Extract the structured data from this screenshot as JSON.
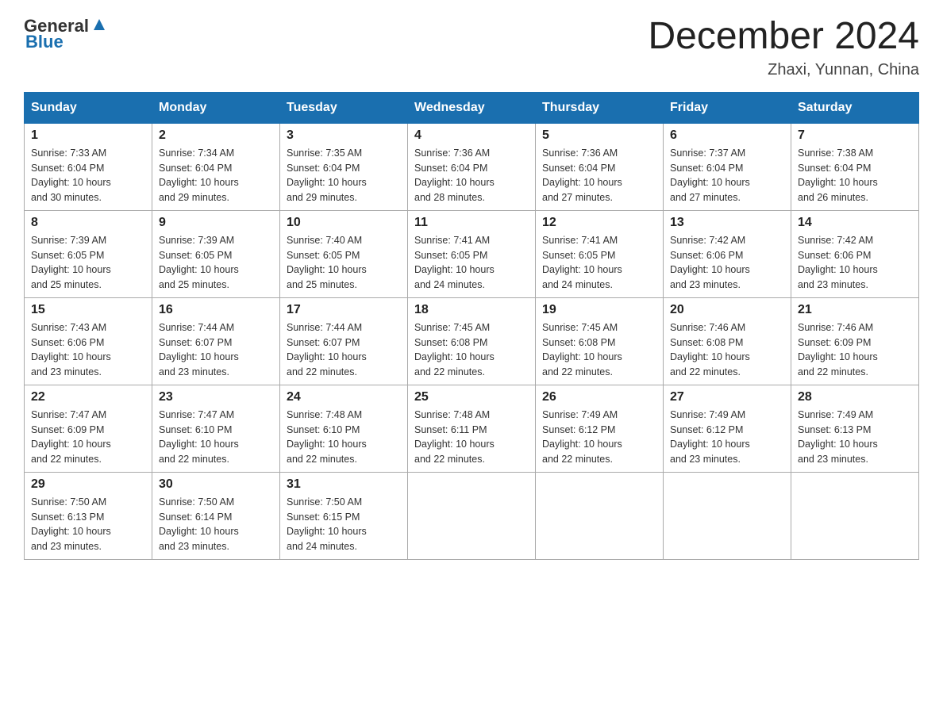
{
  "header": {
    "logo_general": "General",
    "logo_blue": "Blue",
    "month_title": "December 2024",
    "location": "Zhaxi, Yunnan, China"
  },
  "weekdays": [
    "Sunday",
    "Monday",
    "Tuesday",
    "Wednesday",
    "Thursday",
    "Friday",
    "Saturday"
  ],
  "weeks": [
    [
      {
        "day": "1",
        "sunrise": "7:33 AM",
        "sunset": "6:04 PM",
        "daylight": "10 hours and 30 minutes."
      },
      {
        "day": "2",
        "sunrise": "7:34 AM",
        "sunset": "6:04 PM",
        "daylight": "10 hours and 29 minutes."
      },
      {
        "day": "3",
        "sunrise": "7:35 AM",
        "sunset": "6:04 PM",
        "daylight": "10 hours and 29 minutes."
      },
      {
        "day": "4",
        "sunrise": "7:36 AM",
        "sunset": "6:04 PM",
        "daylight": "10 hours and 28 minutes."
      },
      {
        "day": "5",
        "sunrise": "7:36 AM",
        "sunset": "6:04 PM",
        "daylight": "10 hours and 27 minutes."
      },
      {
        "day": "6",
        "sunrise": "7:37 AM",
        "sunset": "6:04 PM",
        "daylight": "10 hours and 27 minutes."
      },
      {
        "day": "7",
        "sunrise": "7:38 AM",
        "sunset": "6:04 PM",
        "daylight": "10 hours and 26 minutes."
      }
    ],
    [
      {
        "day": "8",
        "sunrise": "7:39 AM",
        "sunset": "6:05 PM",
        "daylight": "10 hours and 25 minutes."
      },
      {
        "day": "9",
        "sunrise": "7:39 AM",
        "sunset": "6:05 PM",
        "daylight": "10 hours and 25 minutes."
      },
      {
        "day": "10",
        "sunrise": "7:40 AM",
        "sunset": "6:05 PM",
        "daylight": "10 hours and 25 minutes."
      },
      {
        "day": "11",
        "sunrise": "7:41 AM",
        "sunset": "6:05 PM",
        "daylight": "10 hours and 24 minutes."
      },
      {
        "day": "12",
        "sunrise": "7:41 AM",
        "sunset": "6:05 PM",
        "daylight": "10 hours and 24 minutes."
      },
      {
        "day": "13",
        "sunrise": "7:42 AM",
        "sunset": "6:06 PM",
        "daylight": "10 hours and 23 minutes."
      },
      {
        "day": "14",
        "sunrise": "7:42 AM",
        "sunset": "6:06 PM",
        "daylight": "10 hours and 23 minutes."
      }
    ],
    [
      {
        "day": "15",
        "sunrise": "7:43 AM",
        "sunset": "6:06 PM",
        "daylight": "10 hours and 23 minutes."
      },
      {
        "day": "16",
        "sunrise": "7:44 AM",
        "sunset": "6:07 PM",
        "daylight": "10 hours and 23 minutes."
      },
      {
        "day": "17",
        "sunrise": "7:44 AM",
        "sunset": "6:07 PM",
        "daylight": "10 hours and 22 minutes."
      },
      {
        "day": "18",
        "sunrise": "7:45 AM",
        "sunset": "6:08 PM",
        "daylight": "10 hours and 22 minutes."
      },
      {
        "day": "19",
        "sunrise": "7:45 AM",
        "sunset": "6:08 PM",
        "daylight": "10 hours and 22 minutes."
      },
      {
        "day": "20",
        "sunrise": "7:46 AM",
        "sunset": "6:08 PM",
        "daylight": "10 hours and 22 minutes."
      },
      {
        "day": "21",
        "sunrise": "7:46 AM",
        "sunset": "6:09 PM",
        "daylight": "10 hours and 22 minutes."
      }
    ],
    [
      {
        "day": "22",
        "sunrise": "7:47 AM",
        "sunset": "6:09 PM",
        "daylight": "10 hours and 22 minutes."
      },
      {
        "day": "23",
        "sunrise": "7:47 AM",
        "sunset": "6:10 PM",
        "daylight": "10 hours and 22 minutes."
      },
      {
        "day": "24",
        "sunrise": "7:48 AM",
        "sunset": "6:10 PM",
        "daylight": "10 hours and 22 minutes."
      },
      {
        "day": "25",
        "sunrise": "7:48 AM",
        "sunset": "6:11 PM",
        "daylight": "10 hours and 22 minutes."
      },
      {
        "day": "26",
        "sunrise": "7:49 AM",
        "sunset": "6:12 PM",
        "daylight": "10 hours and 22 minutes."
      },
      {
        "day": "27",
        "sunrise": "7:49 AM",
        "sunset": "6:12 PM",
        "daylight": "10 hours and 23 minutes."
      },
      {
        "day": "28",
        "sunrise": "7:49 AM",
        "sunset": "6:13 PM",
        "daylight": "10 hours and 23 minutes."
      }
    ],
    [
      {
        "day": "29",
        "sunrise": "7:50 AM",
        "sunset": "6:13 PM",
        "daylight": "10 hours and 23 minutes."
      },
      {
        "day": "30",
        "sunrise": "7:50 AM",
        "sunset": "6:14 PM",
        "daylight": "10 hours and 23 minutes."
      },
      {
        "day": "31",
        "sunrise": "7:50 AM",
        "sunset": "6:15 PM",
        "daylight": "10 hours and 24 minutes."
      },
      null,
      null,
      null,
      null
    ]
  ]
}
